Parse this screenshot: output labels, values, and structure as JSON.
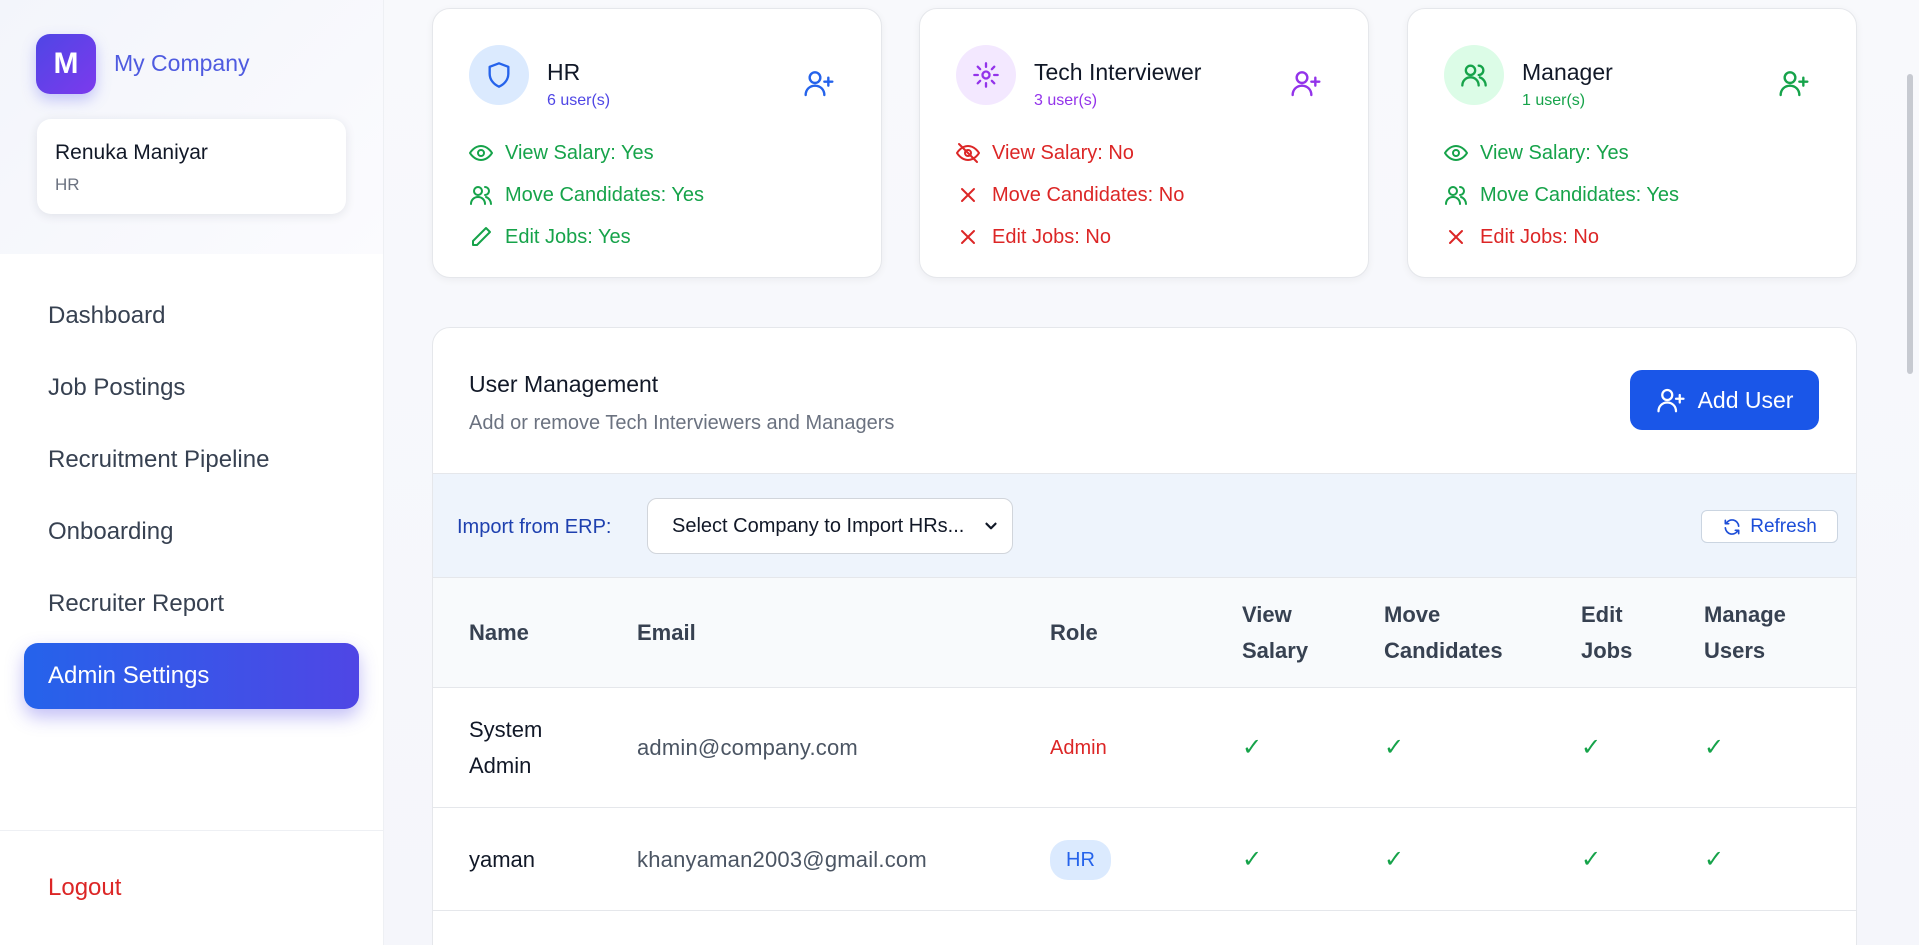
{
  "app": {
    "logo_letter": "M",
    "company_name": "My Company"
  },
  "user": {
    "name": "Renuka Maniyar",
    "role": "HR"
  },
  "nav": {
    "items": [
      {
        "label": "Dashboard"
      },
      {
        "label": "Job Postings"
      },
      {
        "label": "Recruitment Pipeline"
      },
      {
        "label": "Onboarding"
      },
      {
        "label": "Recruiter Report"
      },
      {
        "label": "Admin Settings",
        "active": true
      }
    ],
    "logout": "Logout"
  },
  "roles": [
    {
      "title": "HR",
      "count": "6 user(s)",
      "icon": "shield-icon",
      "color": "#2563eb",
      "perms": [
        {
          "label": "View Salary: Yes",
          "ok": true
        },
        {
          "label": "Move Candidates: Yes",
          "ok": true
        },
        {
          "label": "Edit Jobs: Yes",
          "ok": true
        }
      ]
    },
    {
      "title": "Tech Interviewer",
      "count": "3 user(s)",
      "icon": "gear-icon",
      "color": "#9333ea",
      "perms": [
        {
          "label": "View Salary: No",
          "ok": false
        },
        {
          "label": "Move Candidates: No",
          "ok": false
        },
        {
          "label": "Edit Jobs: No",
          "ok": false
        }
      ]
    },
    {
      "title": "Manager",
      "count": "1 user(s)",
      "icon": "users-icon",
      "color": "#16a34a",
      "perms": [
        {
          "label": "View Salary: Yes",
          "ok": true
        },
        {
          "label": "Move Candidates: Yes",
          "ok": true
        },
        {
          "label": "Edit Jobs: No",
          "ok": false
        }
      ]
    }
  ],
  "user_management": {
    "title": "User Management",
    "subtitle": "Add or remove Tech Interviewers and Managers",
    "add_user_label": "Add User",
    "import_label": "Import from ERP:",
    "select_value": "Select Company to Import HRs...",
    "refresh_label": "Refresh"
  },
  "table": {
    "headers": {
      "name": "Name",
      "email": "Email",
      "role": "Role",
      "view_salary_1": "View",
      "view_salary_2": "Salary",
      "move_1": "Move",
      "move_2": "Candidates",
      "edit_1": "Edit",
      "edit_2": "Jobs",
      "manage_1": "Manage",
      "manage_2": "Users"
    },
    "rows": [
      {
        "name_1": "System",
        "name_2": "Admin",
        "email": "admin@company.com",
        "role": "Admin",
        "view_salary": "✓",
        "move_candidates": "✓",
        "edit_jobs": "✓",
        "manage_users": "✓"
      },
      {
        "name": "yaman",
        "email": "khanyaman2003@gmail.com",
        "role": "HR",
        "view_salary": "✓",
        "move_candidates": "✓",
        "edit_jobs": "✓",
        "manage_users": "✓"
      }
    ]
  }
}
